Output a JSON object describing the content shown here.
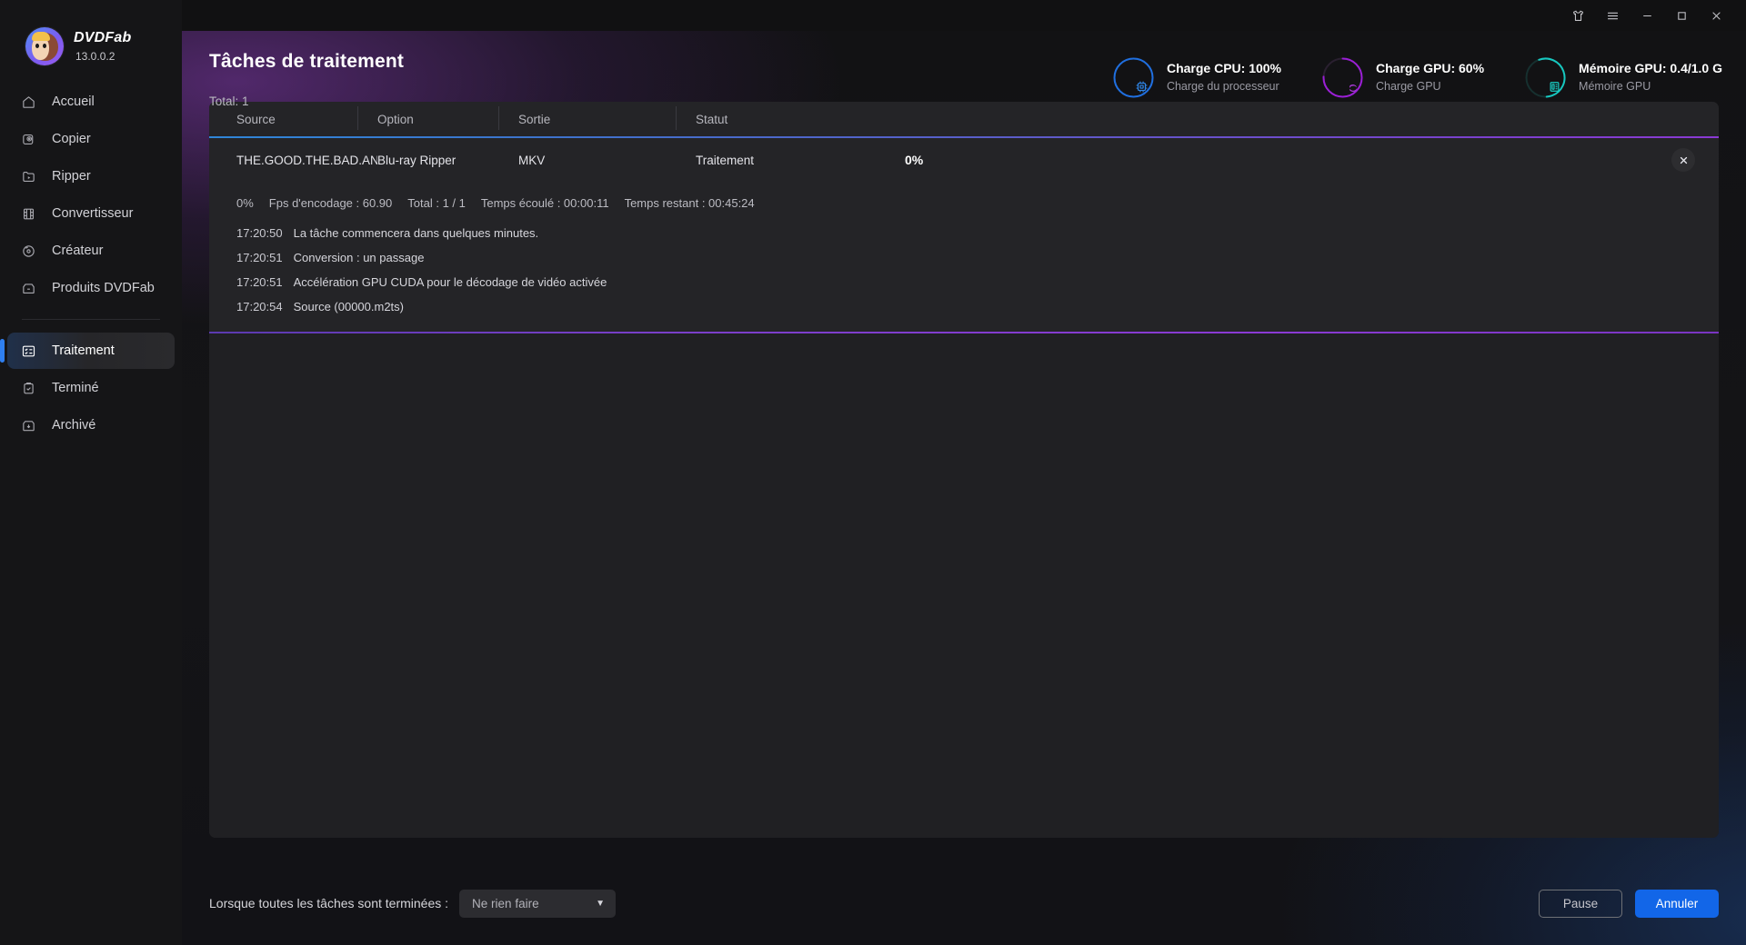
{
  "brand": {
    "name": "DVDFab",
    "version": "13.0.0.2",
    "logo_icon": "dvdfab-mascot-logo"
  },
  "sidebar": {
    "items": [
      {
        "label": "Accueil",
        "icon": "home-icon",
        "active": false
      },
      {
        "label": "Copier",
        "icon": "copy-disc-icon",
        "active": false
      },
      {
        "label": "Ripper",
        "icon": "rip-folder-icon",
        "active": false
      },
      {
        "label": "Convertisseur",
        "icon": "film-convert-icon",
        "active": false
      },
      {
        "label": "Créateur",
        "icon": "disc-create-icon",
        "active": false
      },
      {
        "label": "Produits DVDFab",
        "icon": "box-products-icon",
        "active": false
      }
    ],
    "items_bottom": [
      {
        "label": "Traitement",
        "icon": "task-list-icon",
        "active": true
      },
      {
        "label": "Terminé",
        "icon": "clipboard-check-icon",
        "active": false
      },
      {
        "label": "Archivé",
        "icon": "archive-box-icon",
        "active": false
      }
    ]
  },
  "titlebar": {
    "buttons": [
      {
        "name": "theme-skin-icon",
        "glyph": "tshirt"
      },
      {
        "name": "menu-icon",
        "glyph": "hamburger"
      },
      {
        "name": "minimize-icon",
        "glyph": "minimize"
      },
      {
        "name": "maximize-icon",
        "glyph": "maximize"
      },
      {
        "name": "close-icon",
        "glyph": "close"
      }
    ]
  },
  "header": {
    "title": "Tâches de traitement",
    "total_label": "Total: 1"
  },
  "monitors": [
    {
      "icon": "cpu-chip-icon",
      "title": "Charge CPU: 100%",
      "subtitle": "Charge du processeur",
      "color": "#1f6fe0",
      "percent": 100
    },
    {
      "icon": "nvidia-gpu-icon",
      "title": "Charge GPU: 60%",
      "subtitle": "Charge GPU",
      "color": "#9b1fd6",
      "percent": 60
    },
    {
      "icon": "memory-module-icon",
      "title": "Mémoire GPU: 0.4/1.0 G",
      "subtitle": "Mémoire GPU",
      "color": "#17c8c0",
      "percent": 40
    }
  ],
  "table": {
    "columns": [
      "Source",
      "Option",
      "Sortie",
      "Statut"
    ],
    "rows": [
      {
        "source": "THE.GOOD.THE.BAD.AN...",
        "option": "Blu-ray Ripper",
        "sortie": "MKV",
        "statut": "Traitement",
        "percent": "0%",
        "close_icon": "close-task-icon"
      }
    ]
  },
  "task_detail": {
    "stats": [
      "0%",
      "Fps d'encodage : 60.90",
      "Total : 1 / 1",
      "Temps écoulé : 00:00:11",
      "Temps restant : 00:45:24"
    ],
    "log": [
      {
        "time": "17:20:50",
        "message": "La tâche commencera dans quelques minutes."
      },
      {
        "time": "17:20:51",
        "message": "Conversion : un passage"
      },
      {
        "time": "17:20:51",
        "message": "Accélération GPU CUDA pour le décodage de vidéo activée"
      },
      {
        "time": "17:20:54",
        "message": "Source (00000.m2ts)"
      }
    ]
  },
  "footer": {
    "when_done_label": "Lorsque toutes les tâches sont terminées :",
    "select_value": "Ne rien faire",
    "pause_label": "Pause",
    "cancel_label": "Annuler"
  },
  "colors": {
    "accent_blue": "#1266e8",
    "accent_purple": "#8b3ad4",
    "sidebar_bg": "#151517",
    "panel_bg": "#242427"
  }
}
